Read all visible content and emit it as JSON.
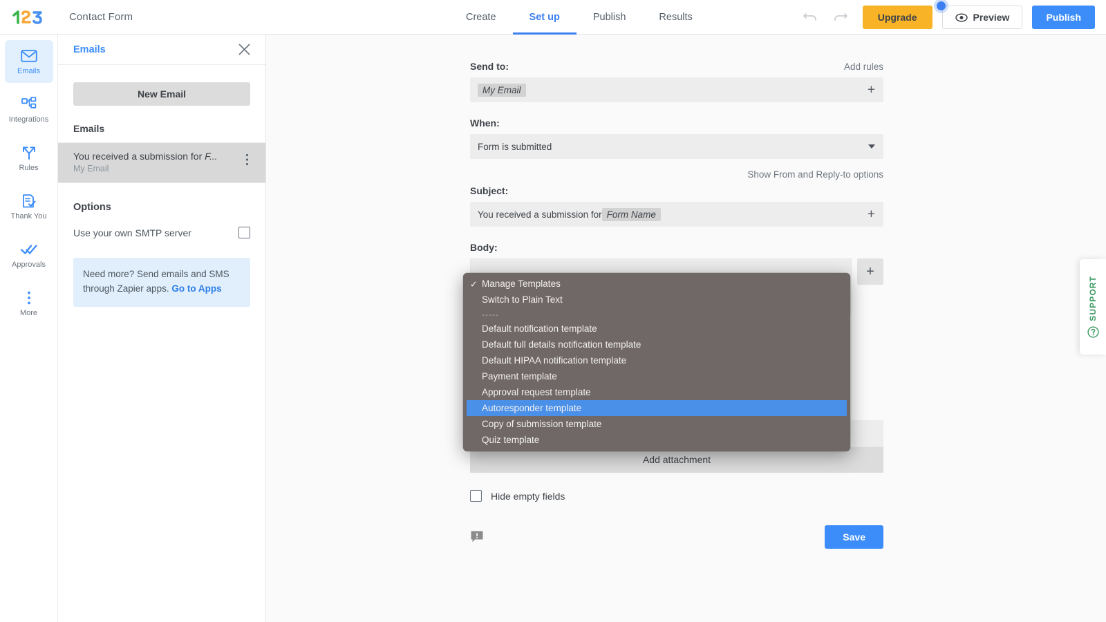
{
  "header": {
    "logo": "123formbuilder-logo",
    "form_title": "Contact Form",
    "tabs": [
      {
        "label": "Create",
        "active": false
      },
      {
        "label": "Set up",
        "active": true
      },
      {
        "label": "Publish",
        "active": false
      },
      {
        "label": "Results",
        "active": false
      }
    ],
    "undo_icon": "undo-icon",
    "redo_icon": "redo-icon",
    "upgrade_label": "Upgrade",
    "preview_label": "Preview",
    "preview_icon": "eye-icon",
    "publish_label": "Publish",
    "accent_blue": "#3c8dfa",
    "upgrade_yellow": "#f8b327"
  },
  "rail": {
    "items": [
      {
        "label": "Emails",
        "icon": "envelope-icon",
        "active": true
      },
      {
        "label": "Integrations",
        "icon": "integrations-icon",
        "active": false
      },
      {
        "label": "Rules",
        "icon": "branch-icon",
        "active": false
      },
      {
        "label": "Thank You",
        "icon": "document-check-icon",
        "active": false
      },
      {
        "label": "Approvals",
        "icon": "double-check-icon",
        "active": false
      },
      {
        "label": "More",
        "icon": "ellipsis-vertical-icon",
        "active": false
      }
    ]
  },
  "panel": {
    "title": "Emails",
    "close_icon": "close-icon",
    "new_email_label": "New Email",
    "emails_section_label": "Emails",
    "emails": [
      {
        "title": "You received a submission for ",
        "title_italic": "F...",
        "subtitle": "My Email",
        "menu_icon": "kebab-menu-icon",
        "selected": true
      }
    ],
    "options_label": "Options",
    "smtp_label": "Use your own SMTP server",
    "smtp_checked": false,
    "zapier_text": "Need more? Send emails and SMS through Zapier apps. ",
    "zapier_link": "Go to Apps"
  },
  "form": {
    "send_to_label": "Send to:",
    "add_rules_label": "Add rules",
    "send_to_token": "My Email",
    "send_to_plus": "+",
    "when_label": "When:",
    "when_value": "Form is submitted",
    "show_from_label": "Show From and Reply-to options",
    "subject_label": "Subject:",
    "subject_text": "You received a submission for ",
    "subject_token": "Form Name",
    "subject_plus": "+",
    "body_label": "Body:",
    "body_plus": "+",
    "add_attachment_label": "Add attachment",
    "hide_empty_label": "Hide empty fields",
    "hide_empty_checked": false,
    "feedback_icon": "feedback-bubble-icon",
    "save_label": "Save"
  },
  "dropdown": {
    "open": true,
    "background": "#6f6866",
    "highlight": "#4a90e8",
    "items": [
      {
        "label": "Manage Templates",
        "checked": true,
        "selected": false,
        "separator": false
      },
      {
        "label": "Switch to Plain Text",
        "checked": false,
        "selected": false,
        "separator": false
      },
      {
        "label": "-----",
        "checked": false,
        "selected": false,
        "separator": true
      },
      {
        "label": "Default notification template",
        "checked": false,
        "selected": false,
        "separator": false
      },
      {
        "label": "Default full details notification template",
        "checked": false,
        "selected": false,
        "separator": false
      },
      {
        "label": "Default HIPAA notification template",
        "checked": false,
        "selected": false,
        "separator": false
      },
      {
        "label": "Payment template",
        "checked": false,
        "selected": false,
        "separator": false
      },
      {
        "label": "Approval request template",
        "checked": false,
        "selected": false,
        "separator": false
      },
      {
        "label": "Autoresponder template",
        "checked": false,
        "selected": true,
        "separator": false
      },
      {
        "label": "Copy of submission template",
        "checked": false,
        "selected": false,
        "separator": false
      },
      {
        "label": "Quiz template",
        "checked": false,
        "selected": false,
        "separator": false
      }
    ]
  },
  "support": {
    "label": "SUPPORT",
    "icon": "question-circle-icon",
    "color": "#3d9a63"
  }
}
